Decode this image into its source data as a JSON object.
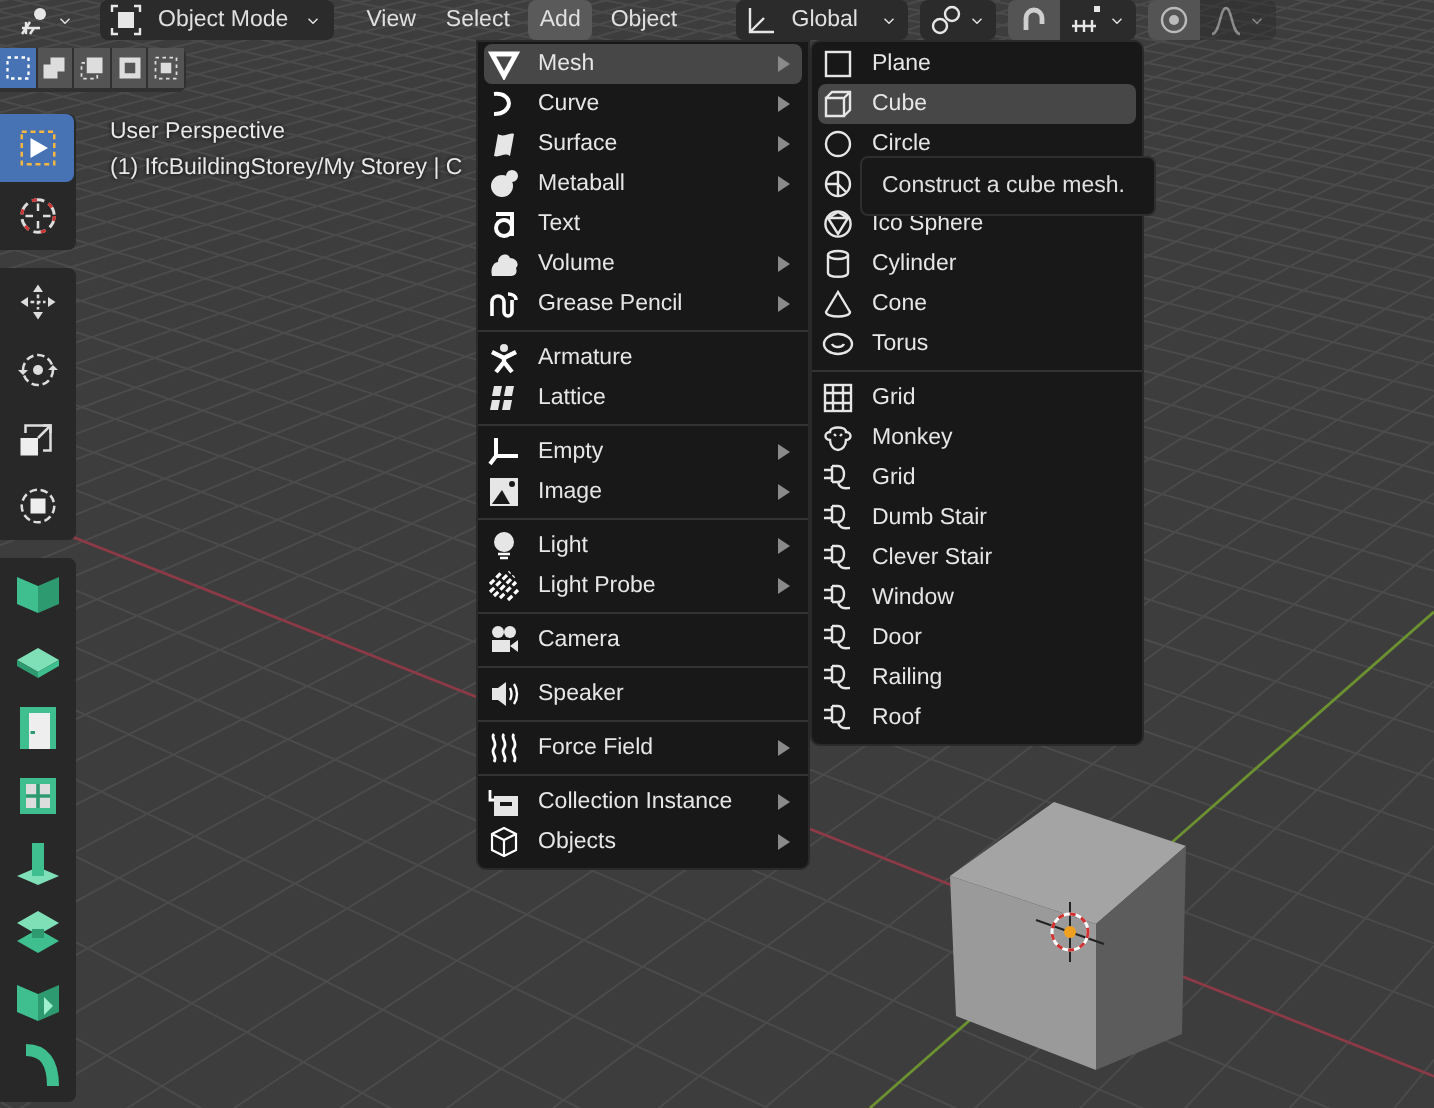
{
  "header": {
    "mode": "Object Mode",
    "menus": [
      {
        "label": "View",
        "selected": false
      },
      {
        "label": "Select",
        "selected": false
      },
      {
        "label": "Add",
        "selected": true
      },
      {
        "label": "Object",
        "selected": false
      }
    ],
    "orientation": "Global",
    "falloff": {
      "disabled": true
    }
  },
  "select_modes": [
    {
      "selected": true
    },
    {
      "selected": false
    },
    {
      "selected": false
    },
    {
      "selected": false
    },
    {
      "selected": false
    }
  ],
  "tool_groups": [
    [
      {
        "selected": true
      },
      {
        "selected": false
      }
    ],
    [
      {
        "selected": false
      },
      {
        "selected": false
      },
      {
        "selected": false
      },
      {
        "selected": false
      }
    ],
    [
      {
        "selected": false
      },
      {
        "selected": false
      },
      {
        "selected": false
      },
      {
        "selected": false
      },
      {
        "selected": false
      },
      {
        "selected": false
      },
      {
        "selected": false
      },
      {
        "selected": false
      }
    ]
  ],
  "viewport": {
    "view_name": "User Perspective",
    "collection_info": "(1) IfcBuildingStorey/My Storey | C"
  },
  "add_menu": {
    "groups": [
      [
        {
          "label": "Mesh",
          "submenu": true,
          "selected": true
        },
        {
          "label": "Curve",
          "submenu": true,
          "selected": false
        },
        {
          "label": "Surface",
          "submenu": true,
          "selected": false
        },
        {
          "label": "Metaball",
          "submenu": true,
          "selected": false
        },
        {
          "label": "Text",
          "submenu": false,
          "selected": false
        },
        {
          "label": "Volume",
          "submenu": true,
          "selected": false
        },
        {
          "label": "Grease Pencil",
          "submenu": true,
          "selected": false
        }
      ],
      [
        {
          "label": "Armature",
          "submenu": false,
          "selected": false
        },
        {
          "label": "Lattice",
          "submenu": false,
          "selected": false
        }
      ],
      [
        {
          "label": "Empty",
          "submenu": true,
          "selected": false
        },
        {
          "label": "Image",
          "submenu": true,
          "selected": false
        }
      ],
      [
        {
          "label": "Light",
          "submenu": true,
          "selected": false
        },
        {
          "label": "Light Probe",
          "submenu": true,
          "selected": false
        }
      ],
      [
        {
          "label": "Camera",
          "submenu": false,
          "selected": false
        }
      ],
      [
        {
          "label": "Speaker",
          "submenu": false,
          "selected": false
        }
      ],
      [
        {
          "label": "Force Field",
          "submenu": true,
          "selected": false
        }
      ],
      [
        {
          "label": "Collection Instance",
          "submenu": true,
          "selected": false
        },
        {
          "label": "Objects",
          "submenu": true,
          "selected": false
        }
      ]
    ]
  },
  "mesh_submenu": {
    "groups": [
      [
        {
          "label": "Plane",
          "selected": false
        },
        {
          "label": "Cube",
          "selected": true
        },
        {
          "label": "Circle",
          "selected": false
        },
        {
          "selected": false
        },
        {
          "label": "Ico Sphere",
          "selected": false
        },
        {
          "label": "Cylinder",
          "selected": false
        },
        {
          "label": "Cone",
          "selected": false
        },
        {
          "label": "Torus",
          "selected": false
        }
      ],
      [
        {
          "label": "Grid",
          "selected": false
        },
        {
          "label": "Monkey",
          "selected": false
        },
        {
          "label": "Grid",
          "selected": false
        },
        {
          "label": "Dumb Stair",
          "selected": false
        },
        {
          "label": "Clever Stair",
          "selected": false
        },
        {
          "label": "Window",
          "selected": false
        },
        {
          "label": "Door",
          "selected": false
        },
        {
          "label": "Railing",
          "selected": false
        },
        {
          "label": "Roof",
          "selected": false
        }
      ]
    ]
  },
  "tooltip": {
    "text": "Construct a cube mesh."
  }
}
